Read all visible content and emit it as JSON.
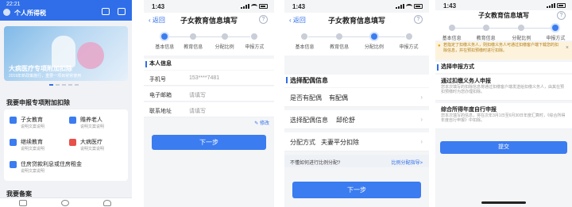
{
  "p1": {
    "status_time": "22:21",
    "header_title": "个人所得税",
    "banner_title": "大病医疗专项附加扣除",
    "banner_sub": "2019年新政策施行，重要一项目常常使用",
    "section_title": "我要申报专项附加扣除",
    "items": [
      {
        "label": "子女教育",
        "sub": "说明文案说明"
      },
      {
        "label": "赡养老人",
        "sub": "说明文案说明"
      },
      {
        "label": "继续教育",
        "sub": "说明文案说明"
      },
      {
        "label": "大病医疗",
        "sub": "说明文案说明"
      },
      {
        "label": "住房贷款利息或住房租金",
        "sub": "说明文案说明"
      }
    ],
    "bottom_title": "我要备案"
  },
  "p2": {
    "status_time": "1:43",
    "back_label": "返回",
    "title": "子女教育信息填写",
    "steps": [
      "基本信息",
      "教育信息",
      "分配比例",
      "申报方式"
    ],
    "active_step": 0,
    "section": "本人信息",
    "rows": [
      {
        "key": "手机号",
        "value": "153****7481"
      },
      {
        "key": "电子邮箱",
        "value": "请填写"
      },
      {
        "key": "联系地址",
        "value": "请填写"
      }
    ],
    "modify_label": "修改",
    "next_label": "下一步"
  },
  "p3": {
    "status_time": "1:43",
    "back_label": "返回",
    "title": "子女教育信息填写",
    "steps": [
      "基本信息",
      "教育信息",
      "分配比例",
      "申报方式"
    ],
    "active_step": 2,
    "section": "选择配偶信息",
    "rows": [
      {
        "key": "是否有配偶",
        "value": "有配偶"
      },
      {
        "key": "选择配偶信息",
        "value": "邱伦舒"
      },
      {
        "key": "分配方式",
        "value": "夫妻平分扣除"
      }
    ],
    "help_question": "不懂如何进行比例分配?",
    "help_link": "比例分配指导>",
    "next_label": "下一步"
  },
  "p4": {
    "status_time": "1:43",
    "title": "子女教育信息填写",
    "steps": [
      "基本信息",
      "教育信息",
      "分配比例",
      "申报方式"
    ],
    "active_step": 3,
    "notice": "若指定了扣缴义务人，则扣缴义务人可通过扣缴客户端下载您的扣除信息，并在预扣预缴时进行扣除。",
    "section": "选择申报方式",
    "option1_title": "通过扣缴义务人申报",
    "option1_desc": "您本次填写的扣除信息将通过扣缴客户端发送给扣缴义务人，由其在预扣预缴时为您办理扣除。",
    "option2_title": "综合所得年度自行申报",
    "option2_desc": "您本次填写的信息，将在次年3月1日至6月30日年度汇算时，《综合所得年度自行申报》中扣除。",
    "submit_label": "提交"
  }
}
